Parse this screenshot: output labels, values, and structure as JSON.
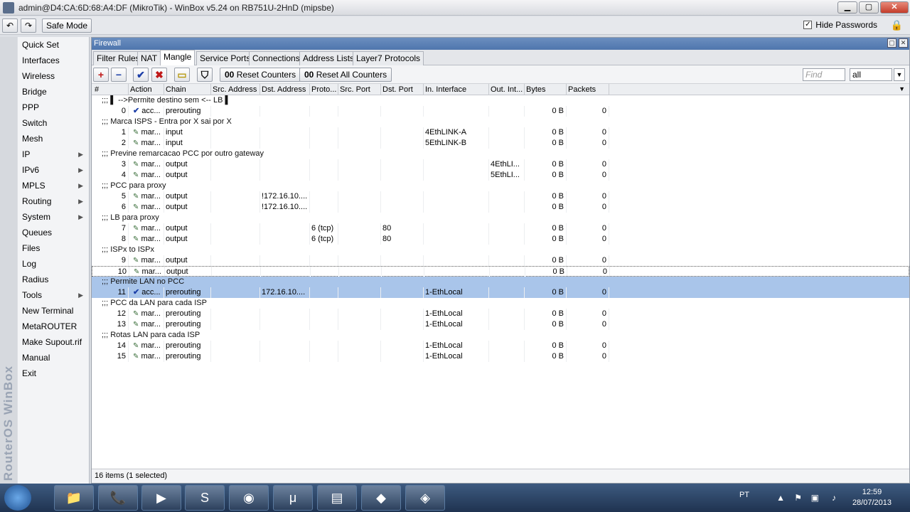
{
  "window": {
    "title": "admin@D4:CA:6D:68:A4:DF (MikroTik) - WinBox v5.24 on RB751U-2HnD (mipsbe)",
    "min": "▁",
    "max": "▢",
    "close": "✕"
  },
  "toolbar": {
    "undo": "↶",
    "redo": "↷",
    "safe_mode": "Safe Mode",
    "hide_passwords": "Hide Passwords",
    "hide_passwords_checked": "✓"
  },
  "brand": "RouterOS WinBox",
  "sidebar": {
    "items": [
      {
        "label": "Quick Set",
        "arrow": ""
      },
      {
        "label": "Interfaces",
        "arrow": ""
      },
      {
        "label": "Wireless",
        "arrow": ""
      },
      {
        "label": "Bridge",
        "arrow": ""
      },
      {
        "label": "PPP",
        "arrow": ""
      },
      {
        "label": "Switch",
        "arrow": ""
      },
      {
        "label": "Mesh",
        "arrow": ""
      },
      {
        "label": "IP",
        "arrow": "▶"
      },
      {
        "label": "IPv6",
        "arrow": "▶"
      },
      {
        "label": "MPLS",
        "arrow": "▶"
      },
      {
        "label": "Routing",
        "arrow": "▶"
      },
      {
        "label": "System",
        "arrow": "▶"
      },
      {
        "label": "Queues",
        "arrow": ""
      },
      {
        "label": "Files",
        "arrow": ""
      },
      {
        "label": "Log",
        "arrow": ""
      },
      {
        "label": "Radius",
        "arrow": ""
      },
      {
        "label": "Tools",
        "arrow": "▶"
      },
      {
        "label": "New Terminal",
        "arrow": ""
      },
      {
        "label": "MetaROUTER",
        "arrow": ""
      },
      {
        "label": "Make Supout.rif",
        "arrow": ""
      },
      {
        "label": "Manual",
        "arrow": ""
      },
      {
        "label": "Exit",
        "arrow": ""
      }
    ]
  },
  "firewall": {
    "title": "Firewall",
    "tabs": [
      "Filter Rules",
      "NAT",
      "Mangle",
      "Service Ports",
      "Connections",
      "Address Lists",
      "Layer7 Protocols"
    ],
    "active_tab": "Mangle",
    "actions": {
      "add": "+",
      "remove": "−",
      "enable": "✔",
      "disable": "✖",
      "comment": "▭",
      "filter": "⛉",
      "reset_counters": "Reset Counters",
      "reset_all_counters": "Reset All Counters",
      "counter_icon": "00"
    },
    "find_placeholder": "Find",
    "filter_select": "all",
    "columns": [
      "#",
      "Action",
      "Chain",
      "Src. Address",
      "Dst. Address",
      "Proto...",
      "Src. Port",
      "Dst. Port",
      "In. Interface",
      "Out. Int...",
      "Bytes",
      "Packets"
    ],
    "rows": [
      {
        "type": "comment",
        "text": ";;; ▌ -->Permite destino sem <-- LB ▌"
      },
      {
        "type": "rule",
        "num": "0",
        "action": "acc...",
        "icon": "✔",
        "chain": "prerouting",
        "src": "",
        "dst": "",
        "proto": "",
        "sport": "",
        "dport": "",
        "inif": "",
        "outif": "",
        "bytes": "0 B",
        "packets": "0"
      },
      {
        "type": "comment",
        "text": ";;; Marca ISPS - Entra por X sai por X"
      },
      {
        "type": "rule",
        "num": "1",
        "action": "mar...",
        "icon": "✎",
        "chain": "input",
        "src": "",
        "dst": "",
        "proto": "",
        "sport": "",
        "dport": "",
        "inif": "4EthLINK-A",
        "outif": "",
        "bytes": "0 B",
        "packets": "0"
      },
      {
        "type": "rule",
        "num": "2",
        "action": "mar...",
        "icon": "✎",
        "chain": "input",
        "src": "",
        "dst": "",
        "proto": "",
        "sport": "",
        "dport": "",
        "inif": "5EthLINK-B",
        "outif": "",
        "bytes": "0 B",
        "packets": "0"
      },
      {
        "type": "comment",
        "text": ";;; Previne remarcacao PCC por outro gateway"
      },
      {
        "type": "rule",
        "num": "3",
        "action": "mar...",
        "icon": "✎",
        "chain": "output",
        "src": "",
        "dst": "",
        "proto": "",
        "sport": "",
        "dport": "",
        "inif": "",
        "outif": "4EthLI...",
        "bytes": "0 B",
        "packets": "0"
      },
      {
        "type": "rule",
        "num": "4",
        "action": "mar...",
        "icon": "✎",
        "chain": "output",
        "src": "",
        "dst": "",
        "proto": "",
        "sport": "",
        "dport": "",
        "inif": "",
        "outif": "5EthLI...",
        "bytes": "0 B",
        "packets": "0"
      },
      {
        "type": "comment",
        "text": ";;; PCC para proxy"
      },
      {
        "type": "rule",
        "num": "5",
        "action": "mar...",
        "icon": "✎",
        "chain": "output",
        "src": "",
        "dst": "!172.16.10....",
        "proto": "",
        "sport": "",
        "dport": "",
        "inif": "",
        "outif": "",
        "bytes": "0 B",
        "packets": "0"
      },
      {
        "type": "rule",
        "num": "6",
        "action": "mar...",
        "icon": "✎",
        "chain": "output",
        "src": "",
        "dst": "!172.16.10....",
        "proto": "",
        "sport": "",
        "dport": "",
        "inif": "",
        "outif": "",
        "bytes": "0 B",
        "packets": "0"
      },
      {
        "type": "comment",
        "text": ";;; LB para proxy"
      },
      {
        "type": "rule",
        "num": "7",
        "action": "mar...",
        "icon": "✎",
        "chain": "output",
        "src": "",
        "dst": "",
        "proto": "6 (tcp)",
        "sport": "",
        "dport": "80",
        "inif": "",
        "outif": "",
        "bytes": "0 B",
        "packets": "0"
      },
      {
        "type": "rule",
        "num": "8",
        "action": "mar...",
        "icon": "✎",
        "chain": "output",
        "src": "",
        "dst": "",
        "proto": "6 (tcp)",
        "sport": "",
        "dport": "80",
        "inif": "",
        "outif": "",
        "bytes": "0 B",
        "packets": "0"
      },
      {
        "type": "comment",
        "text": ";;; ISPx to ISPx"
      },
      {
        "type": "rule",
        "num": "9",
        "action": "mar...",
        "icon": "✎",
        "chain": "output",
        "src": "",
        "dst": "",
        "proto": "",
        "sport": "",
        "dport": "",
        "inif": "",
        "outif": "",
        "bytes": "0 B",
        "packets": "0"
      },
      {
        "type": "rule",
        "num": "10",
        "action": "mar...",
        "icon": "✎",
        "chain": "output",
        "src": "",
        "dst": "",
        "proto": "",
        "sport": "",
        "dport": "",
        "inif": "",
        "outif": "",
        "bytes": "0 B",
        "packets": "0",
        "focus": true
      },
      {
        "type": "comment",
        "text": ";;; Permite LAN no PCC",
        "selected": true
      },
      {
        "type": "rule",
        "num": "11",
        "action": "acc...",
        "icon": "✔",
        "chain": "prerouting",
        "src": "",
        "dst": "172.16.10....",
        "proto": "",
        "sport": "",
        "dport": "",
        "inif": "1-EthLocal",
        "outif": "",
        "bytes": "0 B",
        "packets": "0",
        "selected": true
      },
      {
        "type": "comment",
        "text": ";;; PCC da LAN para cada ISP"
      },
      {
        "type": "rule",
        "num": "12",
        "action": "mar...",
        "icon": "✎",
        "chain": "prerouting",
        "src": "",
        "dst": "",
        "proto": "",
        "sport": "",
        "dport": "",
        "inif": "1-EthLocal",
        "outif": "",
        "bytes": "0 B",
        "packets": "0"
      },
      {
        "type": "rule",
        "num": "13",
        "action": "mar...",
        "icon": "✎",
        "chain": "prerouting",
        "src": "",
        "dst": "",
        "proto": "",
        "sport": "",
        "dport": "",
        "inif": "1-EthLocal",
        "outif": "",
        "bytes": "0 B",
        "packets": "0"
      },
      {
        "type": "comment",
        "text": ";;; Rotas LAN para cada ISP"
      },
      {
        "type": "rule",
        "num": "14",
        "action": "mar...",
        "icon": "✎",
        "chain": "prerouting",
        "src": "",
        "dst": "",
        "proto": "",
        "sport": "",
        "dport": "",
        "inif": "1-EthLocal",
        "outif": "",
        "bytes": "0 B",
        "packets": "0"
      },
      {
        "type": "rule",
        "num": "15",
        "action": "mar...",
        "icon": "✎",
        "chain": "prerouting",
        "src": "",
        "dst": "",
        "proto": "",
        "sport": "",
        "dport": "",
        "inif": "1-EthLocal",
        "outif": "",
        "bytes": "0 B",
        "packets": "0"
      }
    ],
    "status": "16 items (1 selected)"
  },
  "taskbar": {
    "apps": [
      "📁",
      "📞",
      "▶",
      "S",
      "◉",
      "μ",
      "▤",
      "◆",
      "◈"
    ],
    "language": "PT",
    "time": "12:59",
    "date": "28/07/2013"
  }
}
